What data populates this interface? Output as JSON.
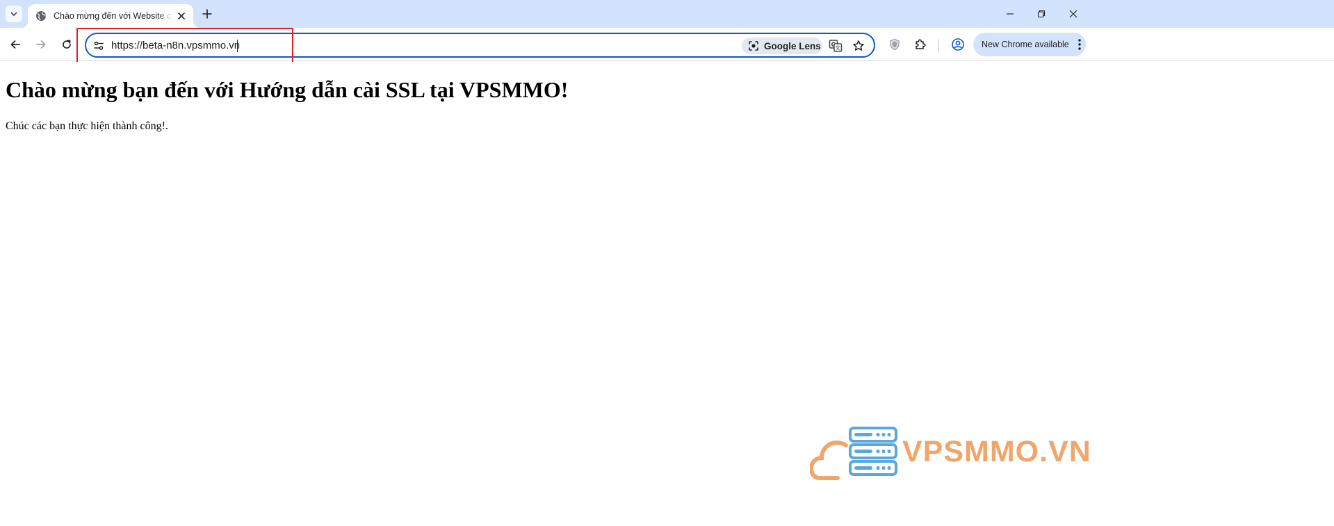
{
  "tab": {
    "title": "Chào mừng đến với Website của",
    "favicon": "globe-icon",
    "close": "close-icon"
  },
  "window_controls": [
    "minimize-icon",
    "restore-icon",
    "close-icon"
  ],
  "toolbar": {
    "back": "arrow-left-icon",
    "forward": "arrow-right-icon",
    "reload": "reload-icon",
    "url": "https://beta-n8n.vpsmmo.vn",
    "lens_label": "Google Lens",
    "translate": "translate-icon",
    "bookmark": "star-icon",
    "extensions": [
      "shield-extension-icon",
      "puzzle-icon"
    ],
    "profile": "profile-icon",
    "update_label": "New Chrome available",
    "menu": "kebab-menu-icon"
  },
  "page": {
    "heading": "Chào mừng bạn đến với Hướng dẫn cài SSL tại VPSMMO!",
    "text": "Chúc các bạn thực hiện thành công!."
  },
  "watermark": {
    "text": "VPSMMO.VN",
    "color": "#f0a66b",
    "icon_color": "#5aa7dc"
  },
  "colors": {
    "tab_strip": "#d3e3fd",
    "omnibox_border": "#0b57d0",
    "annotation": "#e0202a"
  }
}
